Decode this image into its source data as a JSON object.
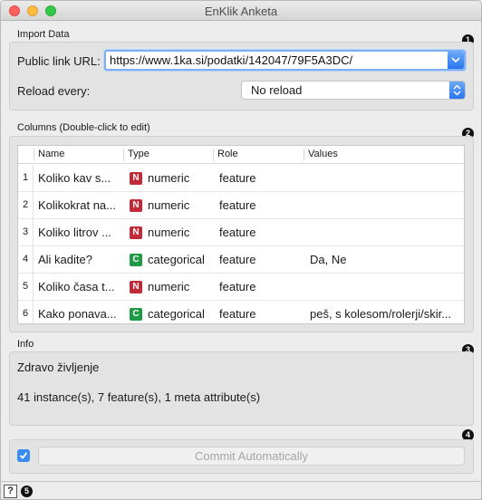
{
  "window": {
    "title": "EnKlik Anketa"
  },
  "import_data": {
    "group_label": "Import Data",
    "url_label": "Public link URL:",
    "url_value": "https://www.1ka.si/podatki/142047/79F5A3DC/",
    "reload_label": "Reload every:",
    "reload_value": "No reload"
  },
  "columns": {
    "group_label": "Columns (Double-click to edit)",
    "headers": [
      "Name",
      "Type",
      "Role",
      "Values"
    ],
    "rows": [
      {
        "num": "1",
        "name": "Koliko kav s...",
        "type_badge": "N",
        "type": "numeric",
        "role": "feature",
        "values": ""
      },
      {
        "num": "2",
        "name": "Kolikokrat na...",
        "type_badge": "N",
        "type": "numeric",
        "role": "feature",
        "values": ""
      },
      {
        "num": "3",
        "name": "Koliko litrov ...",
        "type_badge": "N",
        "type": "numeric",
        "role": "feature",
        "values": ""
      },
      {
        "num": "4",
        "name": "Ali kadite?",
        "type_badge": "C",
        "type": "categorical",
        "role": "feature",
        "values": "Da, Ne"
      },
      {
        "num": "5",
        "name": "Koliko časa t...",
        "type_badge": "N",
        "type": "numeric",
        "role": "feature",
        "values": ""
      },
      {
        "num": "6",
        "name": "Kako ponava...",
        "type_badge": "C",
        "type": "categorical",
        "role": "feature",
        "values": "peš, s kolesom/rolerji/skir..."
      }
    ]
  },
  "info": {
    "group_label": "Info",
    "title": "Zdravo življenje",
    "summary": "41 instance(s), 7 feature(s), 1 meta attribute(s)"
  },
  "commit": {
    "label": "Commit Automatically",
    "checked": true
  },
  "markers": [
    "1",
    "2",
    "3",
    "4",
    "5"
  ],
  "statusbar": {
    "help_icon": "?"
  },
  "colors": {
    "numeric": "#c12a36",
    "categorical": "#1e9a44",
    "accent": "#3b8cf0"
  }
}
